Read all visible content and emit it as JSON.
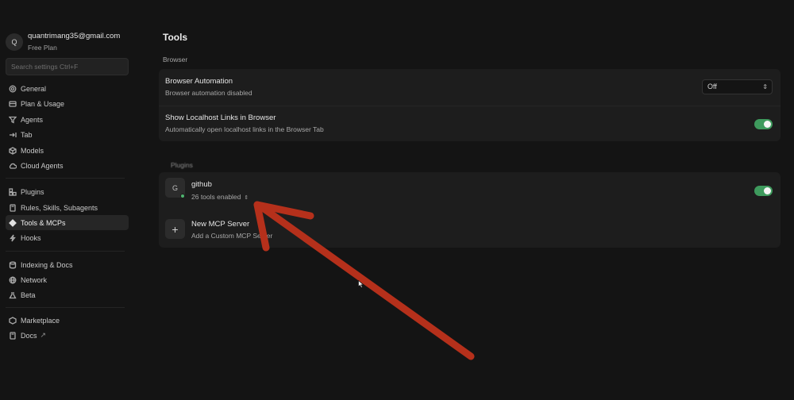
{
  "account": {
    "avatar_letter": "Q",
    "email": "quantrimang35@gmail.com",
    "plan": "Free Plan"
  },
  "search": {
    "placeholder": "Search settings Ctrl+F"
  },
  "sidebar": {
    "items": [
      {
        "label": "General",
        "icon": "gear-icon"
      },
      {
        "label": "Plan & Usage",
        "icon": "card-icon"
      },
      {
        "label": "Agents",
        "icon": "agents-icon"
      },
      {
        "label": "Tab",
        "icon": "tab-icon"
      },
      {
        "label": "Models",
        "icon": "cube-icon"
      },
      {
        "label": "Cloud Agents",
        "icon": "cloud-icon"
      },
      {
        "label": "Plugins",
        "icon": "plugin-icon"
      },
      {
        "label": "Rules, Skills, Subagents",
        "icon": "book-icon"
      },
      {
        "label": "Tools & MCPs",
        "icon": "tools-icon",
        "active": true
      },
      {
        "label": "Hooks",
        "icon": "hook-icon"
      },
      {
        "label": "Indexing & Docs",
        "icon": "database-icon"
      },
      {
        "label": "Network",
        "icon": "globe-icon"
      },
      {
        "label": "Beta",
        "icon": "flask-icon"
      },
      {
        "label": "Marketplace",
        "icon": "marketplace-icon"
      },
      {
        "label": "Docs",
        "icon": "book-icon",
        "external": "↗"
      }
    ]
  },
  "main": {
    "title": "Tools",
    "browser_section": "Browser",
    "browser_automation": {
      "title": "Browser Automation",
      "desc": "Browser automation disabled",
      "select_value": "Off"
    },
    "localhost_links": {
      "title": "Show Localhost Links in Browser",
      "desc": "Automatically open localhost links in the Browser Tab",
      "enabled": true
    },
    "mcp_section": "Plugins",
    "server": {
      "letter": "G",
      "name": "github",
      "tools": "26 tools enabled",
      "enabled": true
    },
    "new_server": {
      "title": "New MCP Server",
      "desc": "Add a Custom MCP Server"
    }
  },
  "colors": {
    "background": "#141414",
    "card": "#1d1d1d",
    "toggle_on": "#3e9a5d",
    "annotation_arrow": "#b5301b"
  }
}
